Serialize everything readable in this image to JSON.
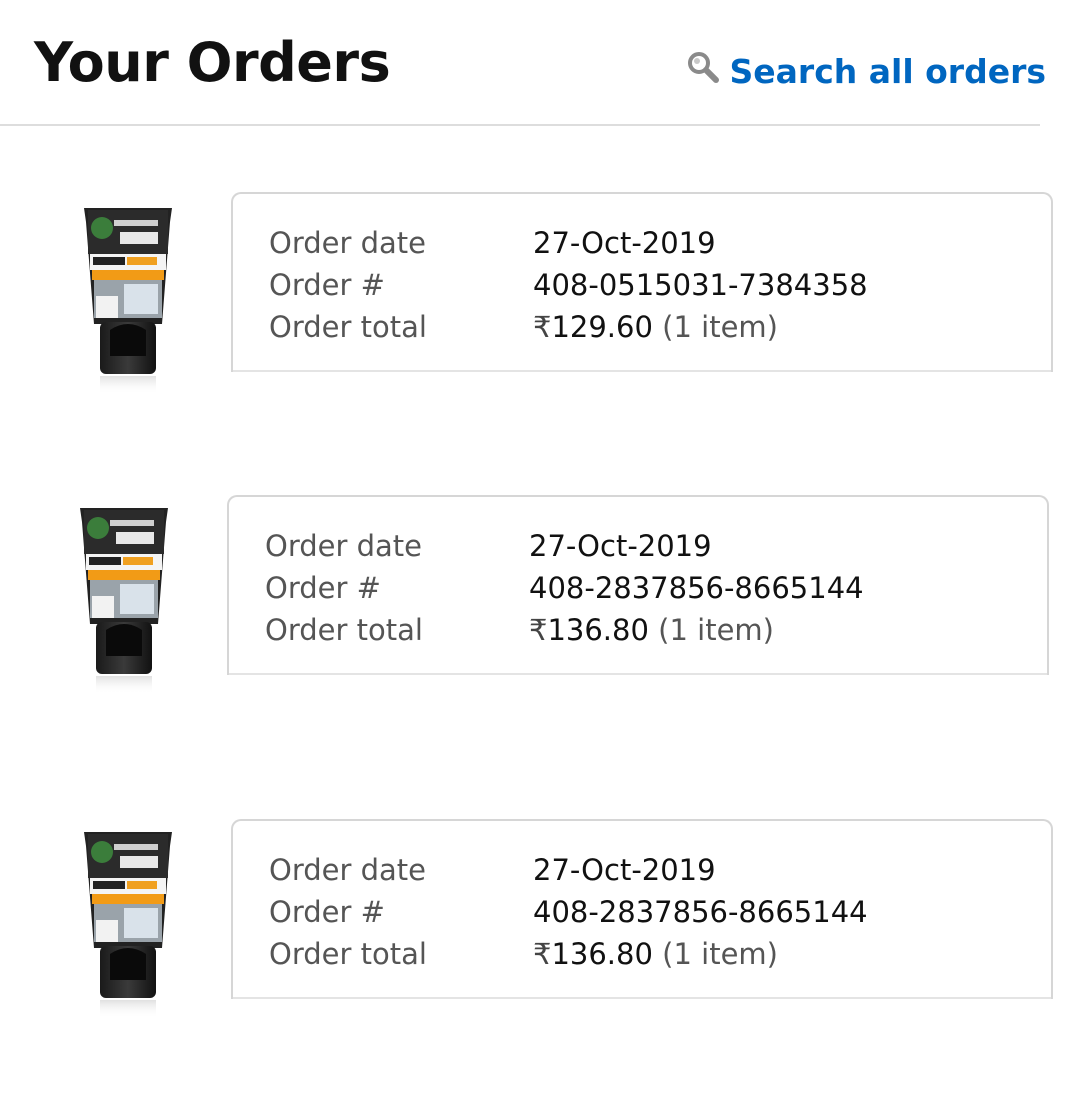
{
  "header": {
    "title": "Your Orders",
    "search_label": "Search all orders",
    "search_icon": "magnifier-icon"
  },
  "orders": [
    {
      "labels": {
        "date": "Order date",
        "number": "Order #",
        "total": "Order total"
      },
      "date": "27-Oct-2019",
      "number": "408-0515031-7384358",
      "currency": "₹",
      "amount": "129.60",
      "items": "(1 item)",
      "product_image": "Garnier Men Power White face wash tube"
    },
    {
      "labels": {
        "date": "Order date",
        "number": "Order #",
        "total": "Order total"
      },
      "date": "27-Oct-2019",
      "number": "408-2837856-8665144",
      "currency": "₹",
      "amount": "136.80",
      "items": "(1 item)",
      "product_image": "Garnier Men Power White face wash tube"
    },
    {
      "labels": {
        "date": "Order date",
        "number": "Order #",
        "total": "Order total"
      },
      "date": "27-Oct-2019",
      "number": "408-2837856-8665144",
      "currency": "₹",
      "amount": "136.80",
      "items": "(1 item)",
      "product_image": "Garnier Men Power White face wash tube"
    }
  ],
  "colors": {
    "link": "#0066c0",
    "label": "#555555",
    "text": "#111111",
    "border": "#d6d6d6"
  }
}
